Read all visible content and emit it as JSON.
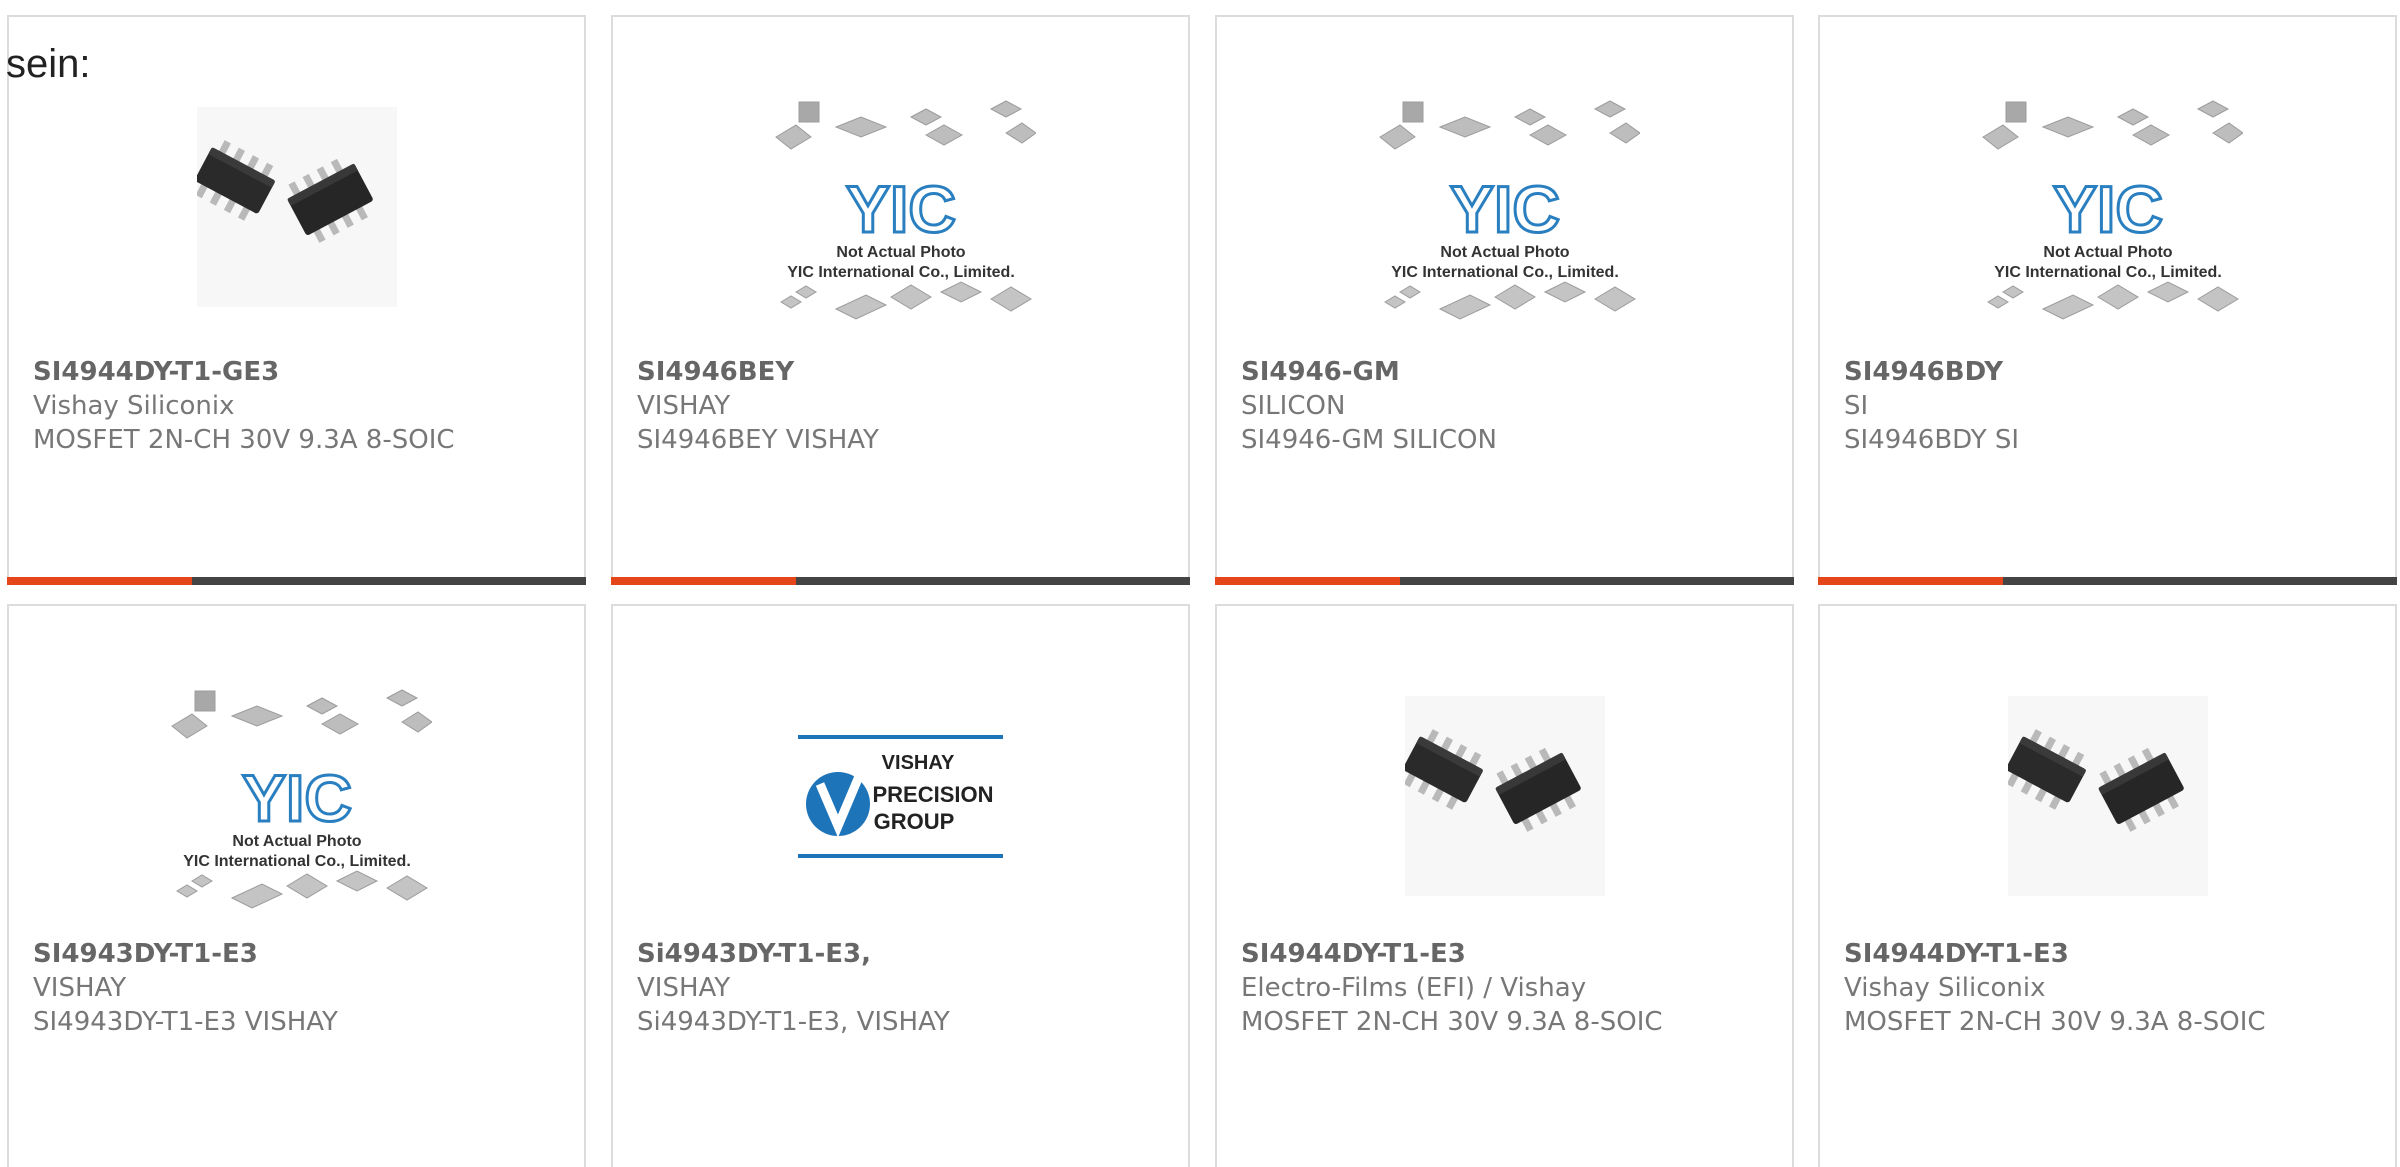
{
  "intro_text": "sein:",
  "colors": {
    "accent": "#e4461a",
    "bar": "#444444",
    "border": "#dcdcdc",
    "yic_blue": "#2a7fc0",
    "vishay_blue": "#1e74b8"
  },
  "products": [
    {
      "part": "SI4944DY-T1-GE3",
      "manufacturer": "Vishay Siliconix",
      "description": "MOSFET 2N-CH 30V 9.3A 8-SOIC",
      "image": "soic8-chip-photo"
    },
    {
      "part": "SI4946BEY",
      "manufacturer": "VISHAY",
      "description": "SI4946BEY VISHAY",
      "image": "yic-placeholder"
    },
    {
      "part": "SI4946-GM",
      "manufacturer": "SILICON",
      "description": "SI4946-GM SILICON",
      "image": "yic-placeholder"
    },
    {
      "part": "SI4946BDY",
      "manufacturer": "SI",
      "description": "SI4946BDY SI",
      "image": "yic-placeholder"
    },
    {
      "part": "SI4943DY-T1-E3",
      "manufacturer": "VISHAY",
      "description": "SI4943DY-T1-E3 VISHAY",
      "image": "yic-placeholder"
    },
    {
      "part": "Si4943DY-T1-E3,",
      "manufacturer": "VISHAY",
      "description": "Si4943DY-T1-E3, VISHAY",
      "image": "vishay-precision-logo"
    },
    {
      "part": "SI4944DY-T1-E3",
      "manufacturer": "Electro-Films (EFI) / Vishay",
      "description": "MOSFET 2N-CH 30V 9.3A 8-SOIC",
      "image": "soic8-chip-photo"
    },
    {
      "part": "SI4944DY-T1-E3",
      "manufacturer": "Vishay Siliconix",
      "description": "MOSFET 2N-CH 30V 9.3A 8-SOIC",
      "image": "soic8-chip-photo"
    }
  ],
  "yic_placeholder": {
    "logo": "YIC",
    "line1": "Not Actual Photo",
    "line2": "YIC International Co., Limited."
  },
  "vishay_logo": {
    "line1": "VISHAY",
    "line2": "PRECISION",
    "line3": "GROUP"
  }
}
